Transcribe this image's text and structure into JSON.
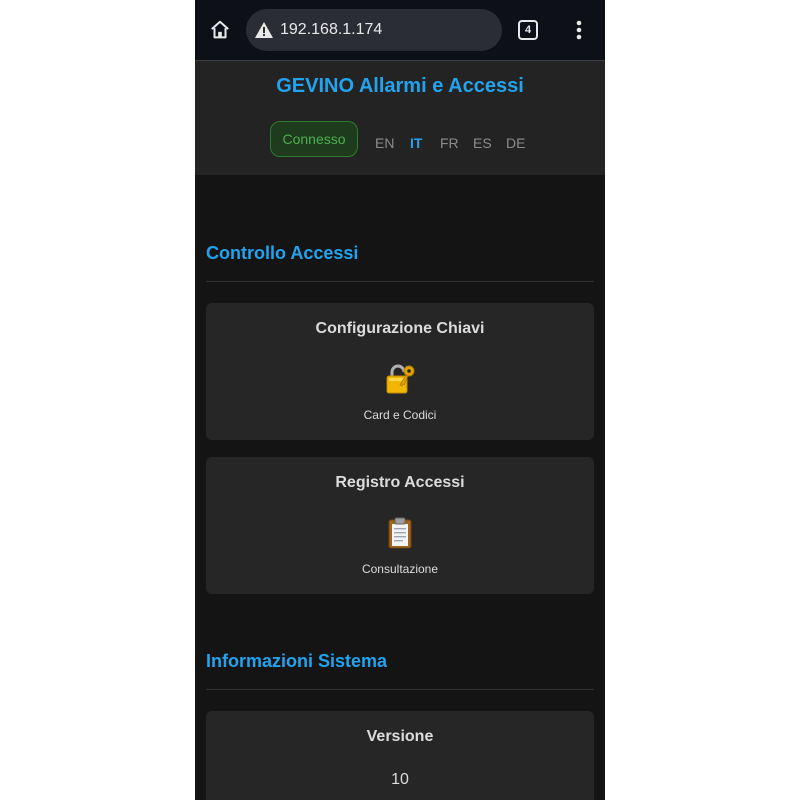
{
  "browser": {
    "url": "192.168.1.174",
    "tab_count": "4",
    "icons": [
      "home-icon",
      "warning-icon",
      "tabs-icon",
      "more-vert-icon"
    ]
  },
  "header": {
    "title": "GEVINO Allarmi e Accessi",
    "status": "Connesso",
    "languages": [
      "EN",
      "IT",
      "FR",
      "ES",
      "DE"
    ],
    "active_language": "IT"
  },
  "sections": [
    {
      "title": "Controllo Accessi",
      "cards": [
        {
          "title": "Configurazione Chiavi",
          "icon": "lock-with-key-icon",
          "subtitle": "Card e Codici"
        },
        {
          "title": "Registro Accessi",
          "icon": "clipboard-icon",
          "subtitle": "Consultazione"
        }
      ]
    },
    {
      "title": "Informazioni Sistema",
      "cards": [
        {
          "title": "Versione",
          "value": "10"
        }
      ]
    }
  ],
  "colors": {
    "accent": "#22a3ee",
    "status_green": "#4caf50",
    "background": "#141414",
    "card": "#262626"
  }
}
